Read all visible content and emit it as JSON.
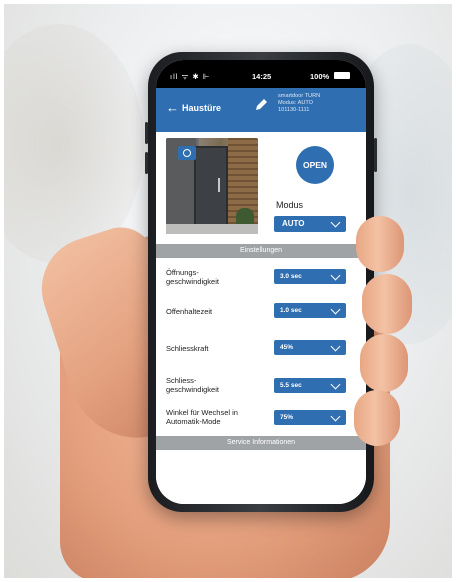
{
  "status_bar": {
    "signal": "ıll ᯤ ✱ ⊩",
    "time": "14:25",
    "battery": "100%"
  },
  "app_bar": {
    "title": "Haustüre",
    "device_name": "smartdoor TURN",
    "device_mode": "Modus: AUTO",
    "device_id": "101130-1111"
  },
  "hero": {
    "open_label": "OPEN",
    "modus_label": "Modus",
    "modus_value": "AUTO"
  },
  "sections": {
    "settings_title": "Einstellungen",
    "service_title": "Service Informationen"
  },
  "settings": [
    {
      "label": "Öffnungs-\ngeschwindigkeit",
      "value": "3.0 sec"
    },
    {
      "label": "Offenhaltezeit",
      "value": "1.0 sec"
    },
    {
      "label": "Schliesskraft",
      "value": "45%"
    },
    {
      "label": "Schliess-\ngeschwindigkeit",
      "value": "5.5 sec"
    },
    {
      "label": "Winkel für Wechsel in\nAutomatik-Mode",
      "value": "75%"
    }
  ],
  "icons": {
    "back": "arrow-left-icon",
    "edit": "pencil-icon",
    "camera": "camera-icon",
    "chevron": "chevron-down-icon"
  },
  "colors": {
    "primary": "#2f6eb1",
    "section_bar": "#a0a3a6"
  }
}
